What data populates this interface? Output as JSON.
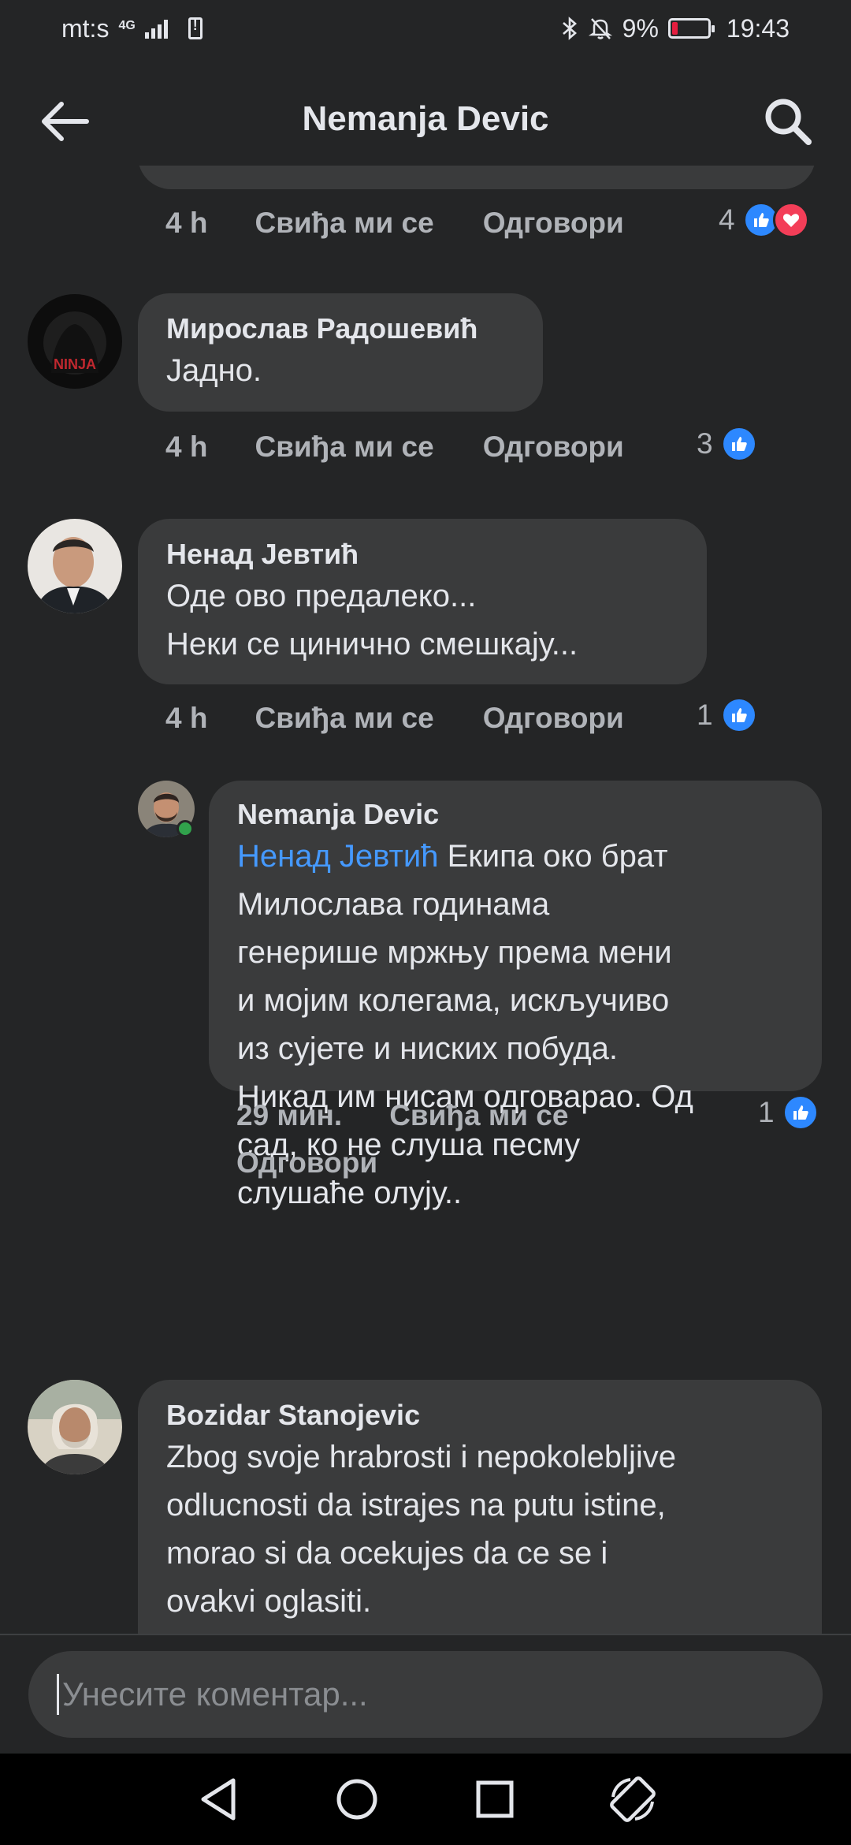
{
  "status_bar": {
    "carrier": "mt:s",
    "network": "4G",
    "battery_percent": "9%",
    "time": "19:43"
  },
  "header": {
    "title": "Nemanja Devic"
  },
  "prev_comment": {
    "time": "4 h",
    "like_label": "Свиђа ми се",
    "reply_label": "Одговори",
    "reaction_count": "4",
    "reactions": [
      "like-icon",
      "love-icon"
    ]
  },
  "comments": [
    {
      "author": "Мирослав Радошевић",
      "text": "Јадно.",
      "time": "4 h",
      "like_label": "Свиђа ми се",
      "reply_label": "Одговори",
      "reaction_count": "3"
    },
    {
      "author": "Ненад Јевтић",
      "text": "Оде ово предалеко...\nНеки се цинично смешкају...",
      "time": "4 h",
      "like_label": "Свиђа ми се",
      "reply_label": "Одговори",
      "reaction_count": "1"
    }
  ],
  "reply": {
    "author": "Nemanja Devic",
    "mention": "Ненад Јевтић",
    "text": "Екипа око брат",
    "lines": [
      "Милослава годинама",
      "генерише мржњу према мени",
      "и мојим колегама, искључиво",
      "из сујете и ниских побуда.",
      "Никад им нисам одговарао. Од",
      "сад, ко не слуша песму",
      "слушаће олују.."
    ],
    "time": "29 мин.",
    "like_label": "Свиђа ми се",
    "reply_label": "Одговори",
    "reaction_count": "1"
  },
  "last_comment": {
    "author": "Bozidar Stanojevic",
    "text": "Zbog svoje hrabrosti i nepokolebljive\nodlucnosti da istrajes na putu istine,\nmorao si da ocekujes da ce se i\novakvi oglasiti."
  },
  "composer": {
    "placeholder": "Унесите коментар..."
  },
  "colors": {
    "background": "#242526",
    "bubble": "#3a3b3c",
    "like_blue": "#2d88ff",
    "love_red": "#f33e58",
    "mention": "#4599ff",
    "secondary_text": "#b0b3b8"
  }
}
